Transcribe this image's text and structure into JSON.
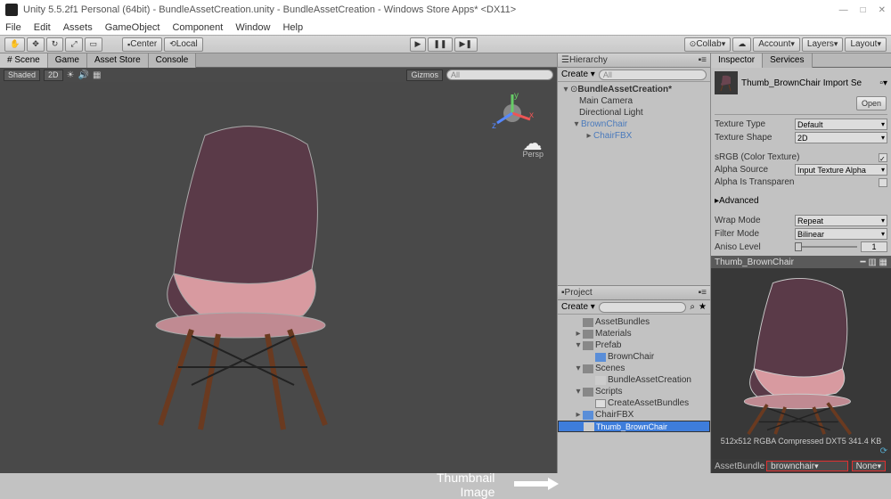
{
  "window": {
    "title": "Unity 5.5.2f1 Personal (64bit) - BundleAssetCreation.unity - BundleAssetCreation - Windows Store Apps* <DX11>",
    "menus": [
      "File",
      "Edit",
      "Assets",
      "GameObject",
      "Component",
      "Window",
      "Help"
    ]
  },
  "toolbar": {
    "center": "Center",
    "local": "Local",
    "collab": "Collab",
    "account": "Account",
    "layers": "Layers",
    "layout": "Layout"
  },
  "scene": {
    "tabs": [
      "# Scene",
      "Game",
      "Asset Store",
      "Console"
    ],
    "shaded": "Shaded",
    "mode2d": "2D",
    "gizmos": "Gizmos",
    "persp": "Persp"
  },
  "hierarchy": {
    "title": "Hierarchy",
    "create": "Create",
    "scene": "BundleAssetCreation*",
    "items": [
      "Main Camera",
      "Directional Light",
      "BrownChair",
      "ChairFBX"
    ]
  },
  "project": {
    "title": "Project",
    "create": "Create",
    "items": [
      {
        "label": "AssetBundles",
        "icon": "folder",
        "indent": 1
      },
      {
        "label": "Materials",
        "icon": "folder",
        "indent": 1,
        "arrow": "▸"
      },
      {
        "label": "Prefab",
        "icon": "folder",
        "indent": 1,
        "arrow": "▾"
      },
      {
        "label": "BrownChair",
        "icon": "prefab",
        "indent": 2
      },
      {
        "label": "Scenes",
        "icon": "folder",
        "indent": 1,
        "arrow": "▾"
      },
      {
        "label": "BundleAssetCreation",
        "icon": "scene",
        "indent": 2
      },
      {
        "label": "Scripts",
        "icon": "folder",
        "indent": 1,
        "arrow": "▾"
      },
      {
        "label": "CreateAssetBundles",
        "icon": "script",
        "indent": 2
      },
      {
        "label": "ChairFBX",
        "icon": "prefab",
        "indent": 1,
        "arrow": "▸"
      },
      {
        "label": "Thumb_BrownChair",
        "icon": "img",
        "indent": 1,
        "sel": true
      }
    ]
  },
  "inspector": {
    "tabs": [
      "Inspector",
      "Services"
    ],
    "asset": "Thumb_BrownChair Import Se",
    "open": "Open",
    "rows": {
      "textureType": {
        "label": "Texture Type",
        "val": "Default"
      },
      "textureShape": {
        "label": "Texture Shape",
        "val": "2D"
      },
      "srgb": {
        "label": "sRGB (Color Texture)"
      },
      "alphaSource": {
        "label": "Alpha Source",
        "val": "Input Texture Alpha"
      },
      "alphaTransp": {
        "label": "Alpha Is Transparen"
      },
      "advanced": "Advanced",
      "wrap": {
        "label": "Wrap Mode",
        "val": "Repeat"
      },
      "filter": {
        "label": "Filter Mode",
        "val": "Bilinear"
      },
      "aniso": {
        "label": "Aniso Level",
        "val": "1"
      }
    },
    "previewTitle": "Thumb_BrownChair",
    "previewInfo": "512x512  RGBA Compressed DXT5  341.4 KB",
    "bundle": {
      "label": "AssetBundle",
      "val": "brownchair",
      "none": "None"
    }
  },
  "annotation": "Thumbnail\nImage"
}
